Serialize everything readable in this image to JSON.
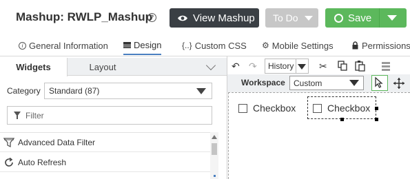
{
  "header": {
    "title": "Mashup: RWLP_Mashup",
    "help_glyph": "?",
    "view_button": "View Mashup",
    "todo_button": "To Do",
    "save_button": "Save"
  },
  "tabs": [
    {
      "label": "General Information",
      "icon": "info-icon"
    },
    {
      "label": "Design",
      "icon": "design-icon",
      "active": true
    },
    {
      "label": "Custom CSS",
      "icon": "css-braces-icon",
      "glyph": "{..}"
    },
    {
      "label": "Mobile Settings",
      "icon": "gear-icon"
    },
    {
      "label": "Permissions",
      "icon": "lock-icon"
    }
  ],
  "left_panel": {
    "tabs": [
      "Widgets",
      "Layout"
    ],
    "category_label": "Category",
    "category_value": "Standard (87)",
    "filter_placeholder": "Filter",
    "widgets": [
      {
        "label": "Advanced Data Filter",
        "icon": "funnel-icon"
      },
      {
        "label": "Auto Refresh",
        "icon": "refresh-icon"
      }
    ]
  },
  "toolbar": {
    "history_label": "History",
    "workspace_label": "Workspace",
    "workspace_value": "Custom"
  },
  "canvas": {
    "checkboxes": [
      {
        "label": "Checkbox",
        "selected": false
      },
      {
        "label": "Checkbox",
        "selected": true
      }
    ]
  },
  "colors": {
    "dark_button": "#3a3f44",
    "disabled_button": "#c7c7c7",
    "save_green": "#5cb85c",
    "active_tab": "#4a7fc0"
  }
}
